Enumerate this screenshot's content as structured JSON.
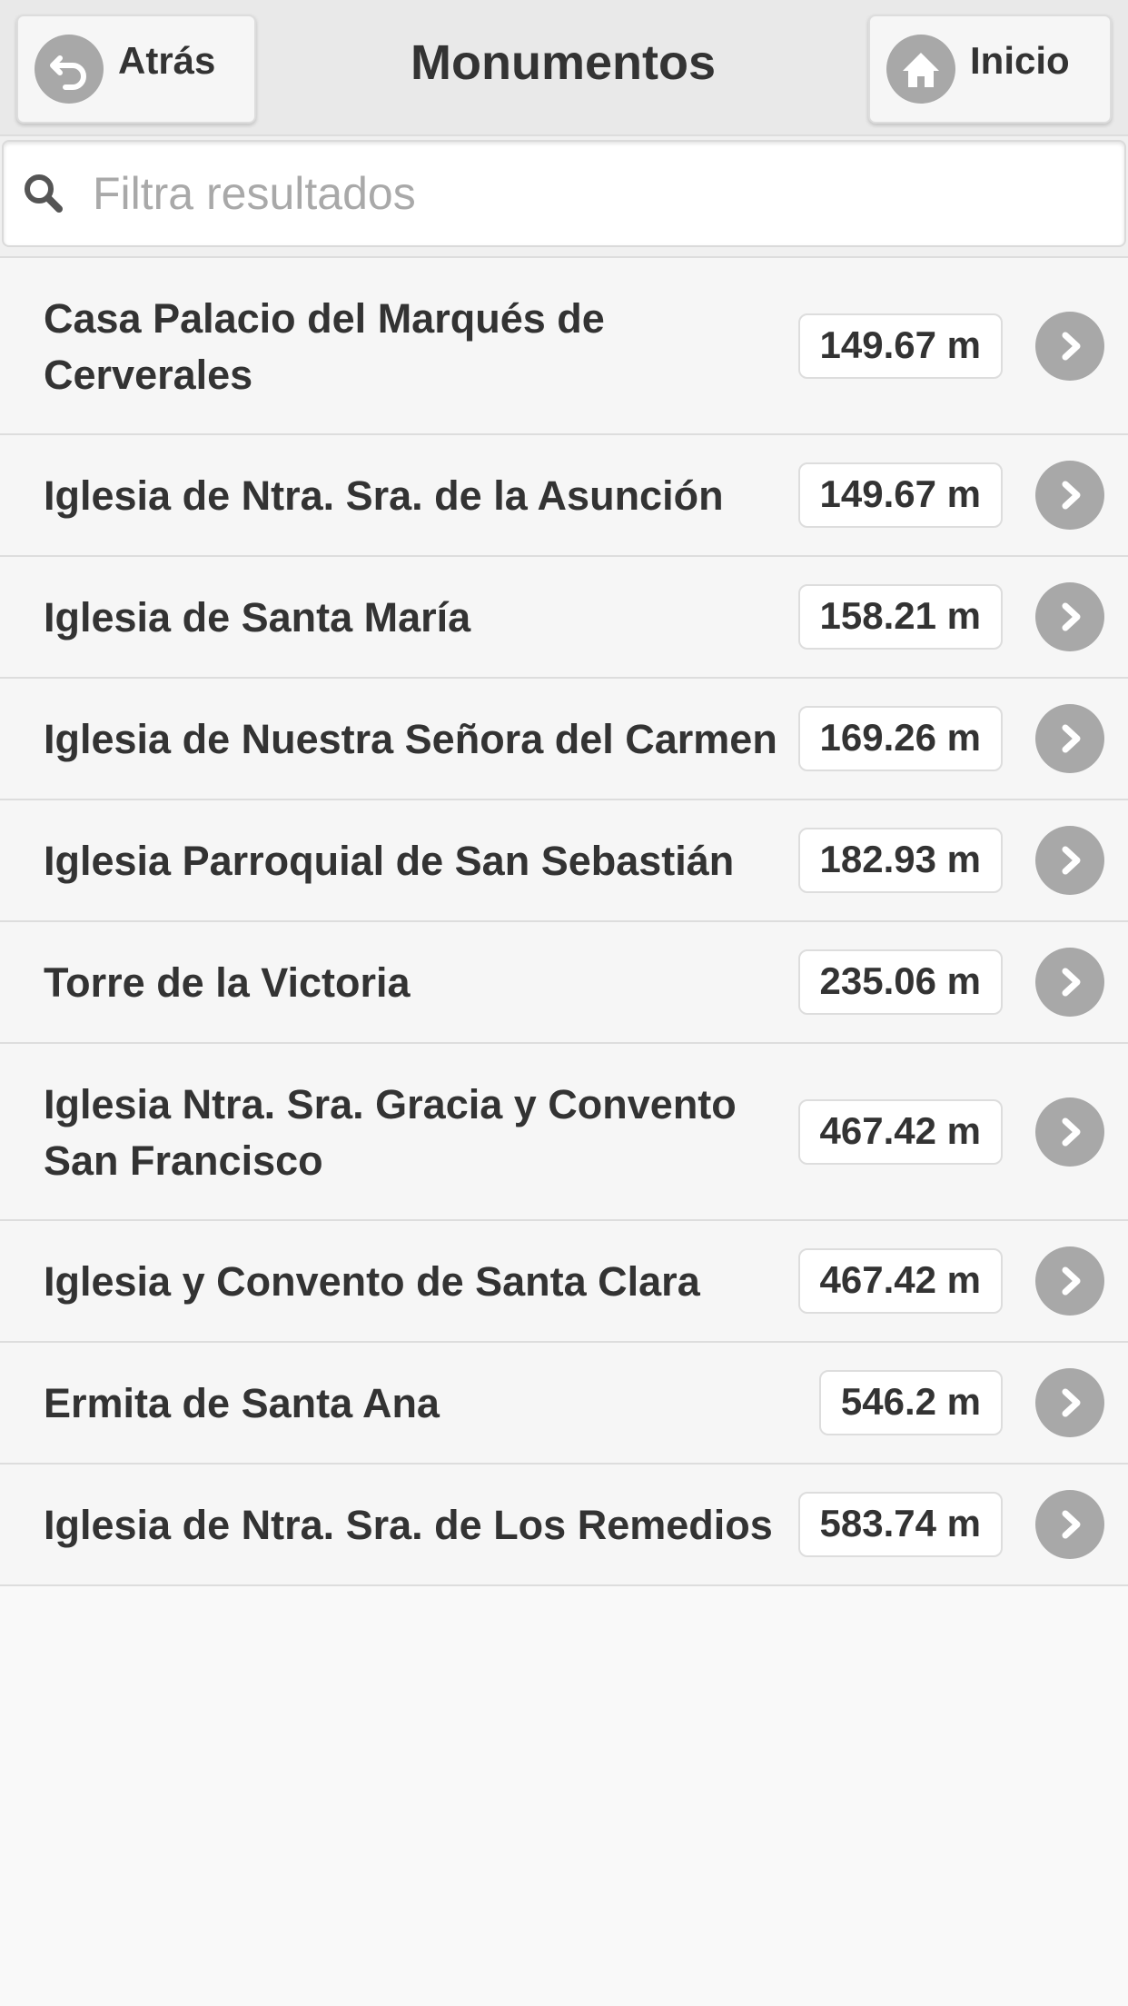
{
  "header": {
    "title": "Monumentos",
    "back_label": "Atrás",
    "home_label": "Inicio"
  },
  "search": {
    "placeholder": "Filtra resultados",
    "value": ""
  },
  "items": [
    {
      "title": "Casa Palacio del Marqués de Cerverales",
      "distance": "149.67 m"
    },
    {
      "title": "Iglesia de Ntra. Sra. de la Asunción",
      "distance": "149.67 m"
    },
    {
      "title": "Iglesia de Santa María",
      "distance": "158.21 m"
    },
    {
      "title": "Iglesia de Nuestra Señora del Carmen",
      "distance": "169.26 m"
    },
    {
      "title": "Iglesia Parroquial de San Sebastián",
      "distance": "182.93 m"
    },
    {
      "title": "Torre de la Victoria",
      "distance": "235.06 m"
    },
    {
      "title": "Iglesia Ntra. Sra. Gracia y Convento San Francisco",
      "distance": "467.42 m"
    },
    {
      "title": "Iglesia y Convento de Santa Clara",
      "distance": "467.42 m"
    },
    {
      "title": "Ermita de Santa Ana",
      "distance": "546.2 m"
    },
    {
      "title": "Iglesia de Ntra. Sra. de Los Remedios",
      "distance": "583.74 m"
    }
  ]
}
